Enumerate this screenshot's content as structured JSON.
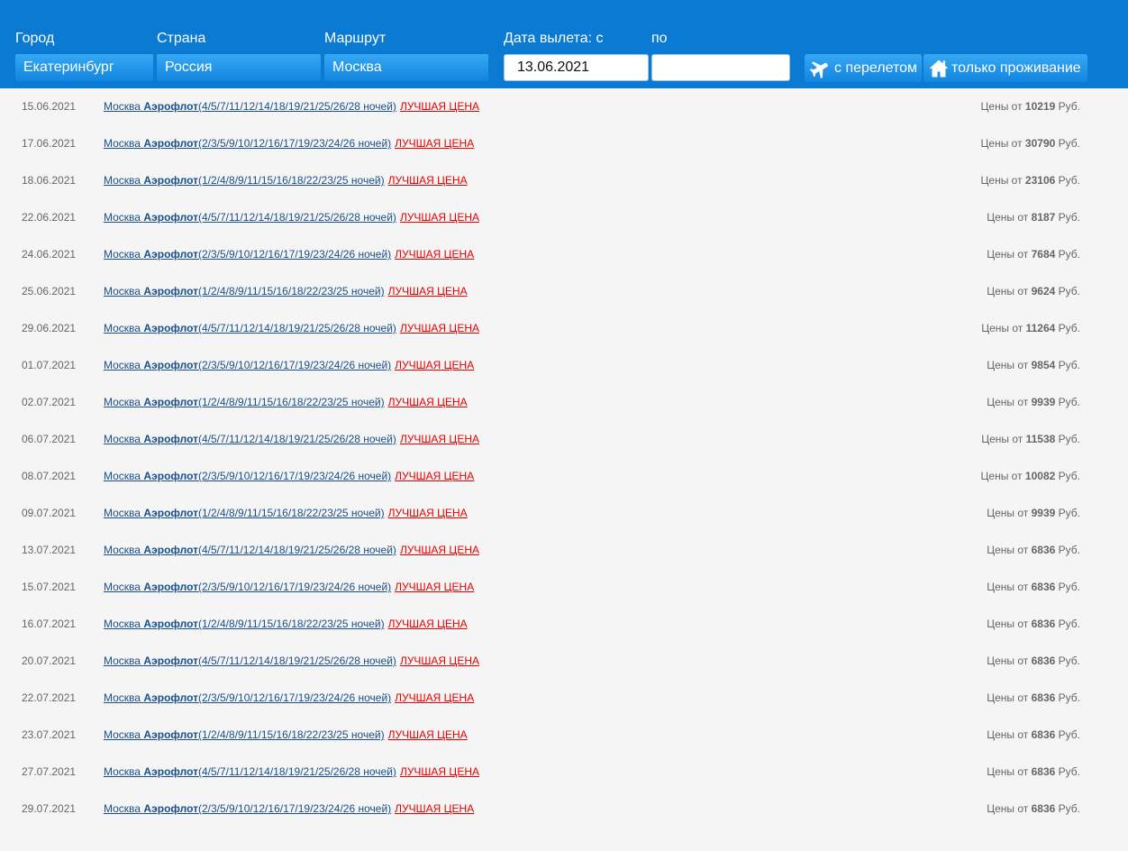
{
  "filters": {
    "city": {
      "label": "Город",
      "value": "Екатеринбург"
    },
    "country": {
      "label": "Страна",
      "value": "Россия"
    },
    "route": {
      "label": "Маршрут",
      "value": "Москва"
    },
    "date_from": {
      "label": "Дата вылета: с",
      "value": "13.06.2021"
    },
    "date_to": {
      "label": "по",
      "value": ""
    },
    "with_flight_button": {
      "label": "с перелетом",
      "icon": "airplane-icon"
    },
    "accommodation_only_button": {
      "label": "только проживание",
      "icon": "house-icon"
    }
  },
  "best_price_label": "ЛУЧШАЯ ЦЕНА",
  "price_prefix": "Цены от",
  "currency": "Руб.",
  "colors": {
    "header_bg": "#0b7ad2",
    "best_price": "#e60000",
    "link": "#1a4f8a"
  },
  "tours": [
    {
      "date": "15.06.2021",
      "city": "Москва",
      "airline": "Аэрофлот",
      "nights": "(4/5/7/11/12/14/18/19/21/25/26/28 ночей)",
      "price": "10219"
    },
    {
      "date": "17.06.2021",
      "city": "Москва",
      "airline": "Аэрофлот",
      "nights": "(2/3/5/9/10/12/16/17/19/23/24/26 ночей)",
      "price": "30790"
    },
    {
      "date": "18.06.2021",
      "city": "Москва",
      "airline": "Аэрофлот",
      "nights": "(1/2/4/8/9/11/15/16/18/22/23/25 ночей)",
      "price": "23106"
    },
    {
      "date": "22.06.2021",
      "city": "Москва",
      "airline": "Аэрофлот",
      "nights": "(4/5/7/11/12/14/18/19/21/25/26/28 ночей)",
      "price": "8187"
    },
    {
      "date": "24.06.2021",
      "city": "Москва",
      "airline": "Аэрофлот",
      "nights": "(2/3/5/9/10/12/16/17/19/23/24/26 ночей)",
      "price": "7684"
    },
    {
      "date": "25.06.2021",
      "city": "Москва",
      "airline": "Аэрофлот",
      "nights": "(1/2/4/8/9/11/15/16/18/22/23/25 ночей)",
      "price": "9624"
    },
    {
      "date": "29.06.2021",
      "city": "Москва",
      "airline": "Аэрофлот",
      "nights": "(4/5/7/11/12/14/18/19/21/25/26/28 ночей)",
      "price": "11264"
    },
    {
      "date": "01.07.2021",
      "city": "Москва",
      "airline": "Аэрофлот",
      "nights": "(2/3/5/9/10/12/16/17/19/23/24/26 ночей)",
      "price": "9854"
    },
    {
      "date": "02.07.2021",
      "city": "Москва",
      "airline": "Аэрофлот",
      "nights": "(1/2/4/8/9/11/15/16/18/22/23/25 ночей)",
      "price": "9939"
    },
    {
      "date": "06.07.2021",
      "city": "Москва",
      "airline": "Аэрофлот",
      "nights": "(4/5/7/11/12/14/18/19/21/25/26/28 ночей)",
      "price": "11538"
    },
    {
      "date": "08.07.2021",
      "city": "Москва",
      "airline": "Аэрофлот",
      "nights": "(2/3/5/9/10/12/16/17/19/23/24/26 ночей)",
      "price": "10082"
    },
    {
      "date": "09.07.2021",
      "city": "Москва",
      "airline": "Аэрофлот",
      "nights": "(1/2/4/8/9/11/15/16/18/22/23/25 ночей)",
      "price": "9939"
    },
    {
      "date": "13.07.2021",
      "city": "Москва",
      "airline": "Аэрофлот",
      "nights": "(4/5/7/11/12/14/18/19/21/25/26/28 ночей)",
      "price": "6836"
    },
    {
      "date": "15.07.2021",
      "city": "Москва",
      "airline": "Аэрофлот",
      "nights": "(2/3/5/9/10/12/16/17/19/23/24/26 ночей)",
      "price": "6836"
    },
    {
      "date": "16.07.2021",
      "city": "Москва",
      "airline": "Аэрофлот",
      "nights": "(1/2/4/8/9/11/15/16/18/22/23/25 ночей)",
      "price": "6836"
    },
    {
      "date": "20.07.2021",
      "city": "Москва",
      "airline": "Аэрофлот",
      "nights": "(4/5/7/11/12/14/18/19/21/25/26/28 ночей)",
      "price": "6836"
    },
    {
      "date": "22.07.2021",
      "city": "Москва",
      "airline": "Аэрофлот",
      "nights": "(2/3/5/9/10/12/16/17/19/23/24/26 ночей)",
      "price": "6836"
    },
    {
      "date": "23.07.2021",
      "city": "Москва",
      "airline": "Аэрофлот",
      "nights": "(1/2/4/8/9/11/15/16/18/22/23/25 ночей)",
      "price": "6836"
    },
    {
      "date": "27.07.2021",
      "city": "Москва",
      "airline": "Аэрофлот",
      "nights": "(4/5/7/11/12/14/18/19/21/25/26/28 ночей)",
      "price": "6836"
    },
    {
      "date": "29.07.2021",
      "city": "Москва",
      "airline": "Аэрофлот",
      "nights": "(2/3/5/9/10/12/16/17/19/23/24/26 ночей)",
      "price": "6836"
    }
  ]
}
